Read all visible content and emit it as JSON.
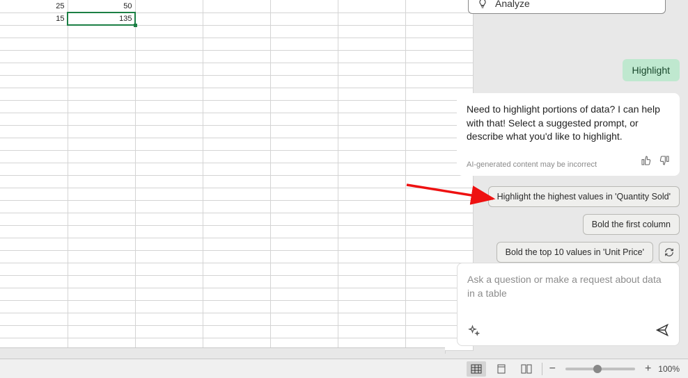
{
  "sheet": {
    "rows": [
      [
        "25",
        "50",
        "",
        "",
        "",
        "",
        ""
      ],
      [
        "15",
        "135",
        "",
        "",
        "",
        "",
        ""
      ]
    ],
    "active": {
      "row": 1,
      "col": 1
    }
  },
  "analyze_card": {
    "label": "Analyze"
  },
  "user_message": "Highlight",
  "assistant": {
    "text": "Need to highlight portions of data? I can help with that! Select a suggested prompt, or describe what you'd like to highlight.",
    "disclaimer": "AI-generated content may be incorrect"
  },
  "suggestions": {
    "s1": "Highlight the highest values in 'Quantity Sold'",
    "s2": "Bold the first column",
    "s3": "Bold the top 10 values in 'Unit Price'"
  },
  "input": {
    "placeholder": "Ask a question or make a request about data in a table"
  },
  "status": {
    "zoom": "100%"
  }
}
